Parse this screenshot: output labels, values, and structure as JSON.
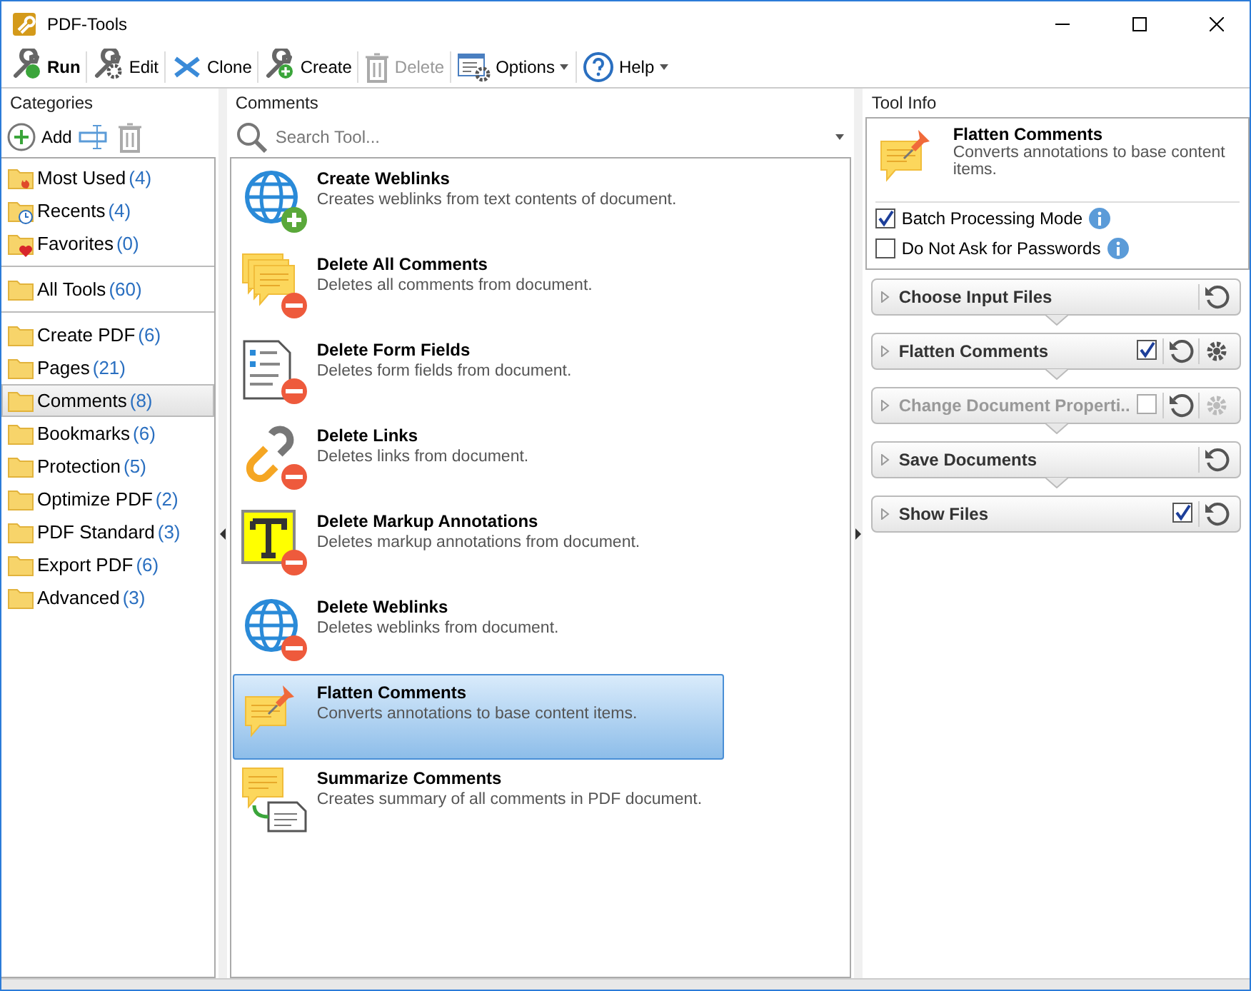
{
  "window": {
    "title": "PDF-Tools"
  },
  "toolbar": [
    {
      "label": "Run",
      "kind": "run",
      "disabled": false,
      "dropdown": false
    },
    {
      "label": "Edit",
      "kind": "edit",
      "disabled": false,
      "dropdown": false
    },
    {
      "label": "Clone",
      "kind": "clone",
      "disabled": false,
      "dropdown": false
    },
    {
      "label": "Create",
      "kind": "create",
      "disabled": false,
      "dropdown": false
    },
    {
      "label": "Delete",
      "kind": "delete",
      "disabled": true,
      "dropdown": false
    },
    {
      "label": "Options",
      "kind": "options",
      "disabled": false,
      "dropdown": true
    },
    {
      "label": "Help",
      "kind": "help",
      "disabled": false,
      "dropdown": true
    }
  ],
  "categories": {
    "header": "Categories",
    "add_label": "Add",
    "groups": [
      [
        {
          "name": "Most Used",
          "count": "(4)",
          "kind": "hot",
          "selected": false
        },
        {
          "name": "Recents",
          "count": "(4)",
          "kind": "clock",
          "selected": false
        },
        {
          "name": "Favorites",
          "count": "(0)",
          "kind": "heart",
          "selected": false
        }
      ],
      [
        {
          "name": "All Tools",
          "count": "(60)",
          "kind": "folder",
          "selected": false
        }
      ],
      [
        {
          "name": "Create PDF",
          "count": "(6)",
          "kind": "folder",
          "selected": false
        },
        {
          "name": "Pages",
          "count": "(21)",
          "kind": "folder",
          "selected": false
        },
        {
          "name": "Comments",
          "count": "(8)",
          "kind": "folder",
          "selected": true
        },
        {
          "name": "Bookmarks",
          "count": "(6)",
          "kind": "folder",
          "selected": false
        },
        {
          "name": "Protection",
          "count": "(5)",
          "kind": "folder",
          "selected": false
        },
        {
          "name": "Optimize PDF",
          "count": "(2)",
          "kind": "folder",
          "selected": false
        },
        {
          "name": "PDF Standard",
          "count": "(3)",
          "kind": "folder",
          "selected": false
        },
        {
          "name": "Export PDF",
          "count": "(6)",
          "kind": "folder",
          "selected": false
        },
        {
          "name": "Advanced",
          "count": "(3)",
          "kind": "folder",
          "selected": false
        }
      ]
    ]
  },
  "comments": {
    "header": "Comments",
    "search": {
      "placeholder": "Search Tool..."
    },
    "tools": [
      {
        "title": "Create Weblinks",
        "description": "Creates weblinks from text contents of document.",
        "kind": "globe_add",
        "selected": false
      },
      {
        "title": "Delete All Comments",
        "description": "Deletes all comments from document.",
        "kind": "comments_delete",
        "selected": false
      },
      {
        "title": "Delete Form Fields",
        "description": "Deletes form fields from document.",
        "kind": "form_delete",
        "selected": false
      },
      {
        "title": "Delete Links",
        "description": "Deletes links from document.",
        "kind": "link_delete",
        "selected": false
      },
      {
        "title": "Delete Markup Annotations",
        "description": "Deletes markup annotations from document.",
        "kind": "markup_delete",
        "selected": false
      },
      {
        "title": "Delete Weblinks",
        "description": "Deletes weblinks from document.",
        "kind": "globe_delete",
        "selected": false
      },
      {
        "title": "Flatten Comments",
        "description": "Converts annotations to base content items.",
        "kind": "flatten",
        "selected": true
      },
      {
        "title": "Summarize Comments",
        "description": "Creates summary of all comments in PDF document.",
        "kind": "summarize",
        "selected": false
      }
    ]
  },
  "tool_info": {
    "header": "Tool Info",
    "title": "Flatten Comments",
    "description": "Converts annotations to base content items.",
    "options": [
      {
        "label": "Batch Processing Mode",
        "checked": true
      },
      {
        "label": "Do Not Ask for Passwords",
        "checked": false
      }
    ],
    "steps": [
      {
        "label": "Choose Input Files",
        "disabled": false,
        "kind": "plain"
      },
      {
        "label": "Flatten Comments",
        "disabled": false,
        "kind": "full",
        "checked": true
      },
      {
        "label": "Change Document Properti..",
        "disabled": true,
        "kind": "full",
        "checked": false
      },
      {
        "label": "Save Documents",
        "disabled": false,
        "kind": "plain"
      },
      {
        "label": "Show Files",
        "disabled": false,
        "kind": "check",
        "checked": true
      }
    ]
  }
}
